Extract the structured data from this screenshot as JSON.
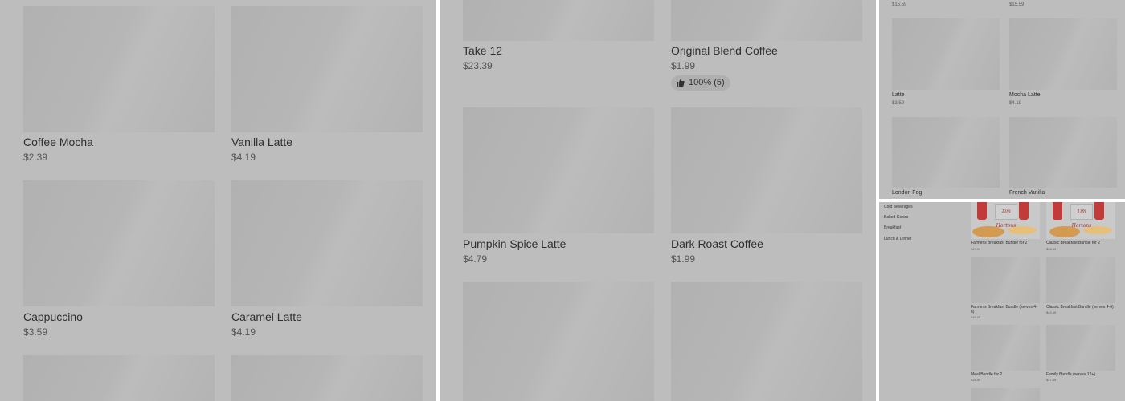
{
  "panel1": {
    "items": [
      {
        "name": "Coffee Mocha",
        "price": "$2.39"
      },
      {
        "name": "Vanilla Latte",
        "price": "$4.19"
      },
      {
        "name": "Cappuccino",
        "price": "$3.59"
      },
      {
        "name": "Caramel Latte",
        "price": "$4.19"
      }
    ]
  },
  "panel2": {
    "items": [
      {
        "name": "Take 12",
        "price": "$23.39"
      },
      {
        "name": "Original Blend Coffee",
        "price": "$1.99",
        "rating": "100% (5)"
      },
      {
        "name": "Pumpkin Spice Latte",
        "price": "$4.79"
      },
      {
        "name": "Dark Roast Coffee",
        "price": "$1.99"
      }
    ]
  },
  "panel3": {
    "top_prices": [
      "$15.59",
      "$15.59"
    ],
    "items": [
      {
        "name": "Latte",
        "price": "$3.59"
      },
      {
        "name": "Mocha Latte",
        "price": "$4.19"
      },
      {
        "name": "London Fog",
        "price": ""
      },
      {
        "name": "French Vanilla",
        "price": ""
      }
    ]
  },
  "panel4": {
    "categories": [
      "Cold Beverages",
      "Baked Goods",
      "Breakfast",
      "Lunch & Dinner"
    ],
    "items": [
      {
        "name": "Farmer's Breakfast Bundle for 2",
        "price": "$29.99"
      },
      {
        "name": "Classic Breakfast Bundle for 2",
        "price": "$28.59"
      },
      {
        "name": "Farmer's Breakfast Bundle (serves 4-6)",
        "price": "$45.29"
      },
      {
        "name": "Classic Breakfast Bundle (serves 4-6)",
        "price": "$40.59"
      },
      {
        "name": "Meal Bundle for 2",
        "price": "$28.49"
      },
      {
        "name": "Family Bundle (serves 12+)",
        "price": "$47.09"
      }
    ],
    "brand_text": "Tim Hortons"
  },
  "colors": {
    "overlay": "#bdbdbd",
    "placeholder": "#b3b3b3",
    "cup_red": "#c23a3a",
    "text": "#2f2f2f"
  },
  "icons": {
    "rating": "thumbs-up-icon"
  }
}
